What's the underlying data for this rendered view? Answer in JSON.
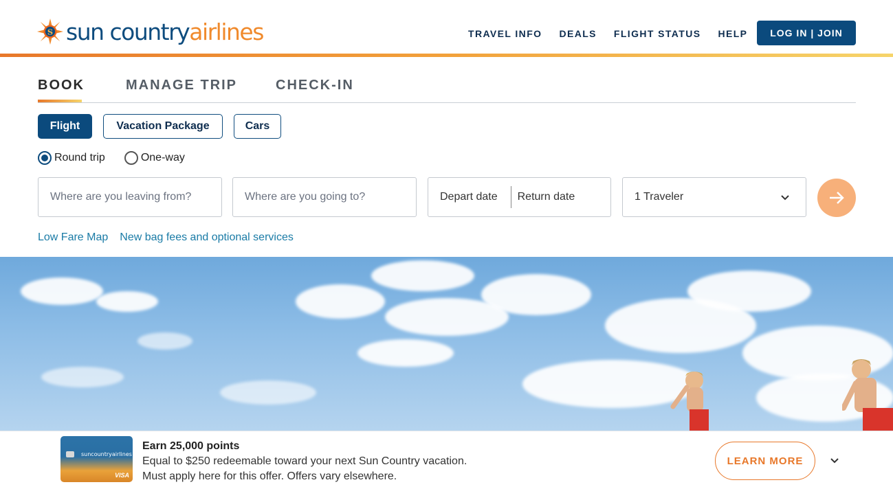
{
  "header": {
    "logo_word1": "sun country",
    "logo_word2": "airlines",
    "nav": [
      "TRAVEL INFO",
      "DEALS",
      "FLIGHT STATUS",
      "HELP"
    ],
    "login_label": "LOG IN | JOIN"
  },
  "booking": {
    "tabs": [
      "BOOK",
      "MANAGE TRIP",
      "CHECK-IN"
    ],
    "active_tab": "BOOK",
    "modes": [
      "Flight",
      "Vacation Package",
      "Cars"
    ],
    "active_mode": "Flight",
    "trip_types": [
      "Round trip",
      "One-way"
    ],
    "selected_trip_type": "Round trip",
    "origin_placeholder": "Where are you leaving from?",
    "destination_placeholder": "Where are you going to?",
    "depart_label": "Depart date",
    "return_label": "Return date",
    "travelers_value": "1 Traveler",
    "links": [
      "Low Fare Map",
      "New bag fees and optional services"
    ]
  },
  "promo": {
    "card_brand": "suncountryairlines",
    "card_network": "VISA",
    "title": "Earn 25,000 points",
    "line1": "Equal to $250 redeemable toward your next Sun Country vacation.",
    "line2": "Must apply here for this offer. Offers vary elsewhere.",
    "cta": "LEARN MORE"
  },
  "colors": {
    "brand_blue": "#0b4a7d",
    "brand_orange": "#e8782a",
    "link_teal": "#1a7ba6"
  }
}
